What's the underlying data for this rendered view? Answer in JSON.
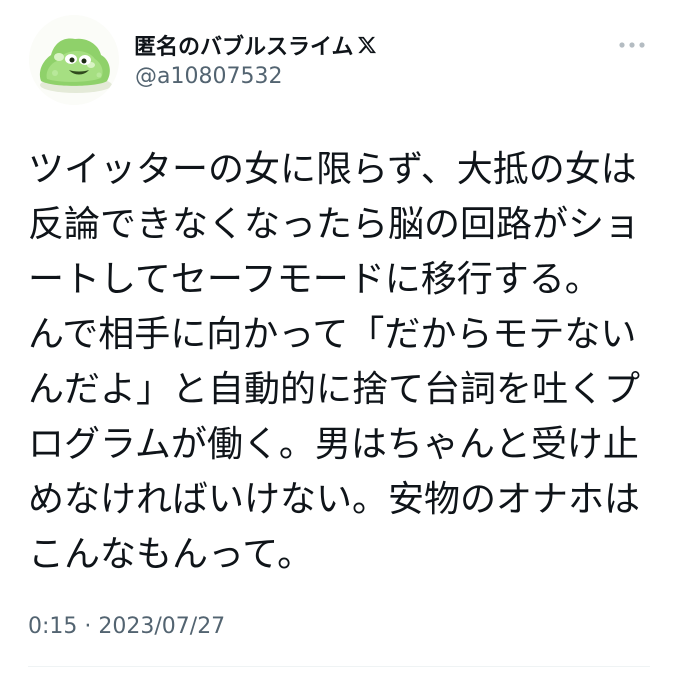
{
  "tweet": {
    "author": {
      "display_name": "匿名のバブルスライム",
      "handle": "@a10807532",
      "avatar_icon": "bubble-slime-avatar",
      "platform_badge_icon": "x-logo-icon"
    },
    "more_icon": "ellipsis-icon",
    "text_lines": [
      "ツイッターの女に限らず、大抵の女は",
      "反論できなくなったら脳の回路がショ",
      "ートしてセーフモードに移行する。",
      "んで相手に向かって「だからモテない",
      "んだよ」と自動的に捨て台詞を吐くプ",
      "ログラムが働く。男はちゃんと受け止",
      "めなければいけない。安物のオナホは",
      "こんなもんって。"
    ],
    "timestamp": "0:15 · 2023/07/27"
  },
  "colors": {
    "text_primary": "#0f1419",
    "text_secondary": "#536471",
    "divider": "#eff3f4",
    "avatar_slime": "#8fd16a"
  }
}
